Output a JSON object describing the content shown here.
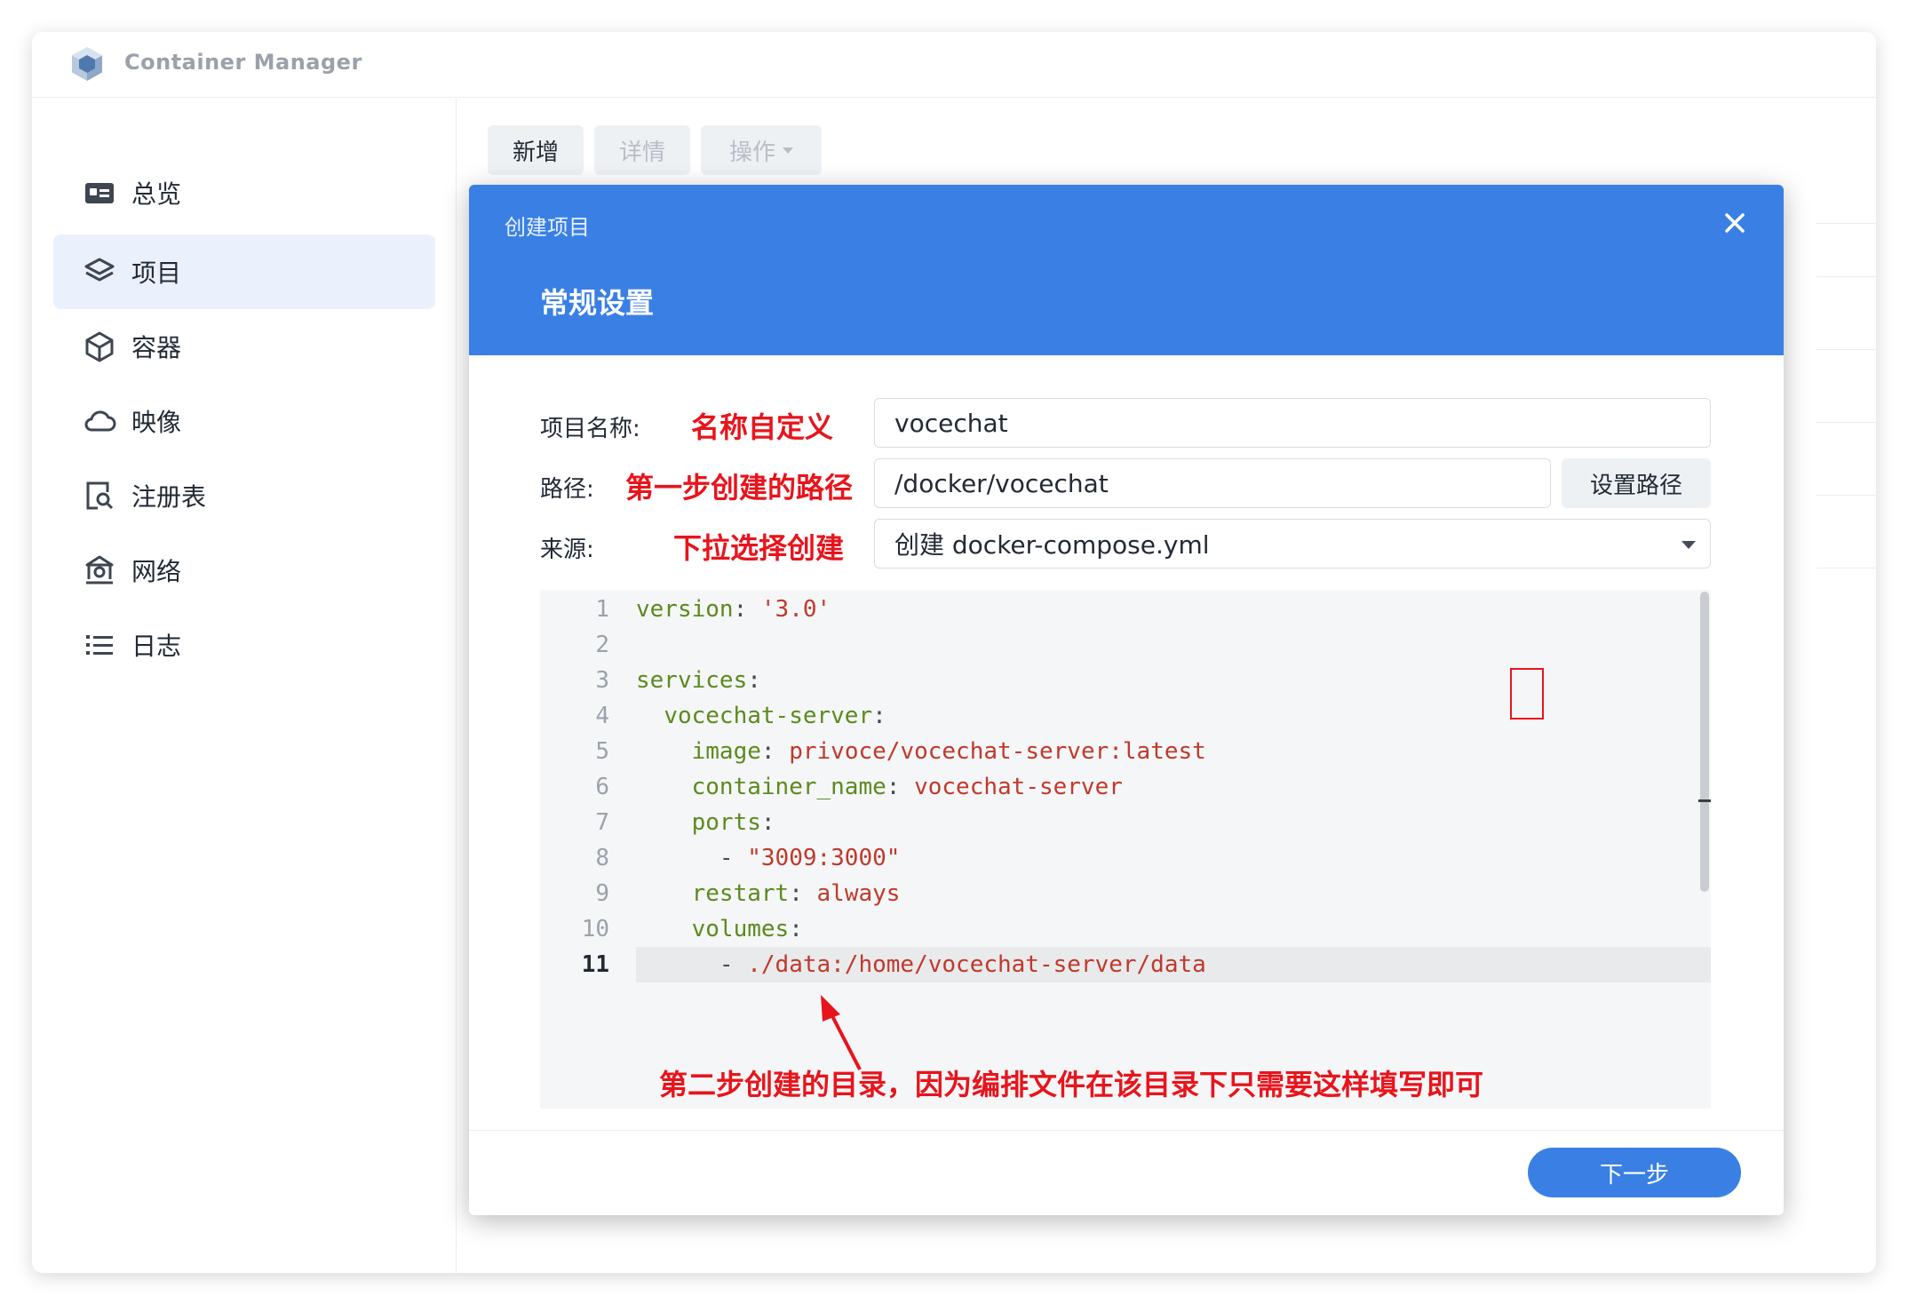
{
  "app": {
    "title": "Container Manager"
  },
  "sidebar": {
    "items": [
      {
        "label": "总览",
        "icon": "overview-icon"
      },
      {
        "label": "项目",
        "icon": "layers-icon",
        "active": true
      },
      {
        "label": "容器",
        "icon": "cube-icon"
      },
      {
        "label": "映像",
        "icon": "cloud-icon"
      },
      {
        "label": "注册表",
        "icon": "registry-search-icon"
      },
      {
        "label": "网络",
        "icon": "network-icon"
      },
      {
        "label": "日志",
        "icon": "list-icon"
      }
    ]
  },
  "toolbar": {
    "new_label": "新增",
    "detail_label": "详情",
    "ops_label": "操作"
  },
  "modal": {
    "title": "创建项目",
    "subtitle": "常规设置",
    "fields": {
      "name_label": "项目名称:",
      "name_value": "vocechat",
      "path_label": "路径:",
      "path_value": "/docker/vocechat",
      "path_button": "设置路径",
      "source_label": "来源:",
      "source_value": "创建 docker-compose.yml"
    },
    "annotations": {
      "name": "名称自定义",
      "path": "第一步创建的路径",
      "source": "下拉选择创建",
      "editor": "第二步创建的目录，因为编排文件在该目录下只需要这样填写即可"
    },
    "code_lines": [
      {
        "num": "1",
        "indent": "",
        "key": "version",
        "sep": ": ",
        "value": "'3.0'"
      },
      {
        "num": "2",
        "indent": "",
        "key": "",
        "sep": "",
        "value": ""
      },
      {
        "num": "3",
        "indent": "",
        "key": "services",
        "sep": ":",
        "value": ""
      },
      {
        "num": "4",
        "indent": "  ",
        "key": "vocechat-server",
        "sep": ":",
        "value": ""
      },
      {
        "num": "5",
        "indent": "    ",
        "key": "image",
        "sep": ": ",
        "value": "privoce/vocechat-server:latest"
      },
      {
        "num": "6",
        "indent": "    ",
        "key": "container_name",
        "sep": ": ",
        "value": "vocechat-server"
      },
      {
        "num": "7",
        "indent": "    ",
        "key": "ports",
        "sep": ":",
        "value": ""
      },
      {
        "num": "8",
        "indent": "      ",
        "key": "",
        "sep": "- ",
        "value": "\"3009:3000\""
      },
      {
        "num": "9",
        "indent": "    ",
        "key": "restart",
        "sep": ": ",
        "value": "always"
      },
      {
        "num": "10",
        "indent": "    ",
        "key": "volumes",
        "sep": ":",
        "value": ""
      },
      {
        "num": "11",
        "indent": "      ",
        "key": "",
        "sep": "- ",
        "value": "./data:/home/vocechat-server/data",
        "current": true
      }
    ],
    "next_button": "下一步"
  },
  "colors": {
    "accent": "#3a80e4",
    "annotation": "#e8141c",
    "yaml_key": "#5c8a1e",
    "yaml_value": "#c0392b"
  }
}
